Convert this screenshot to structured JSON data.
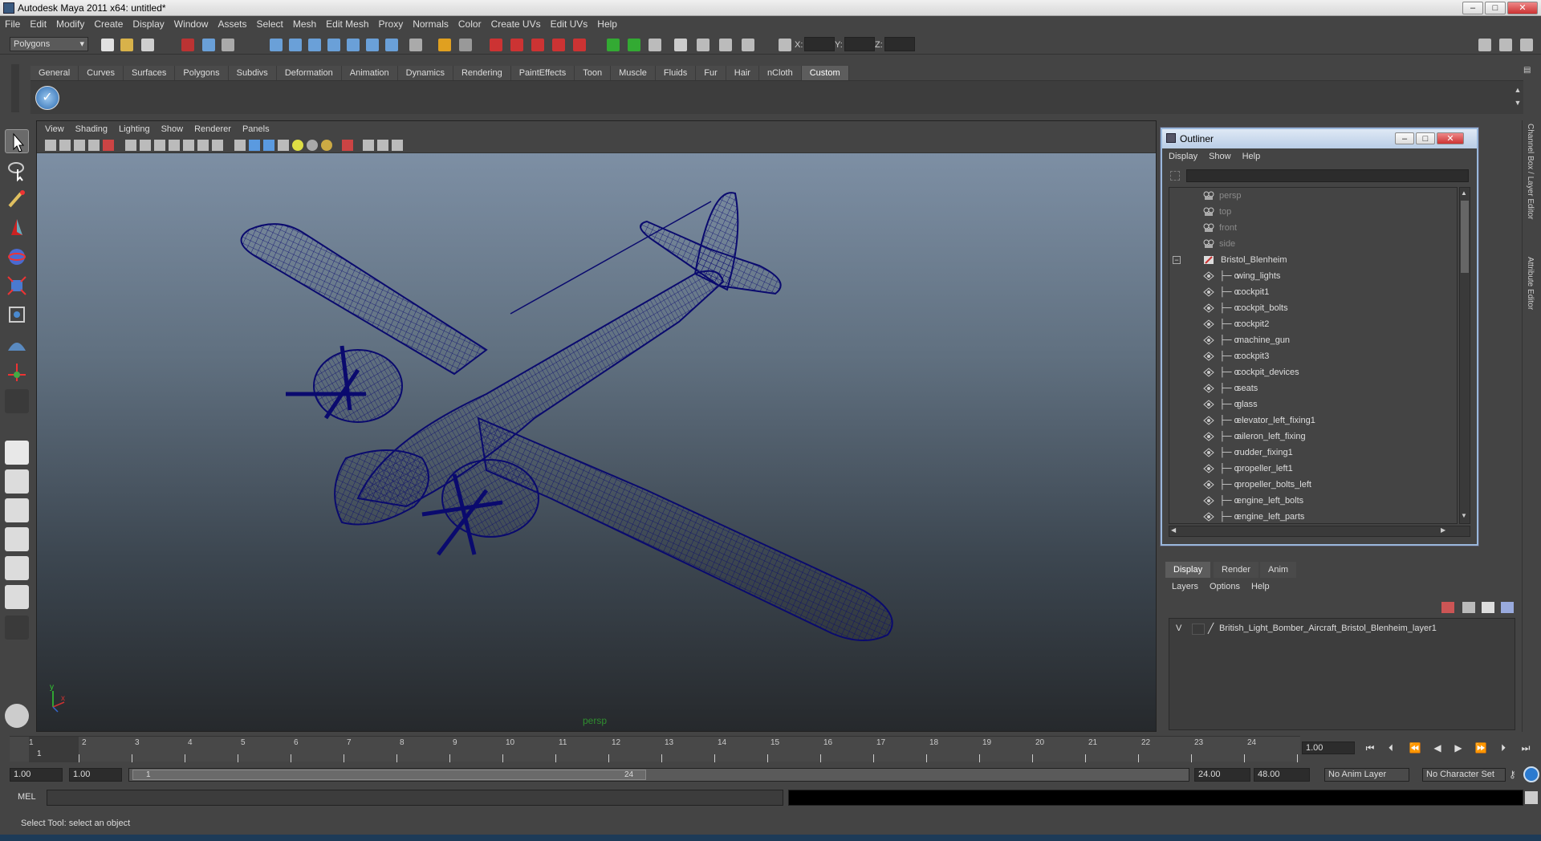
{
  "window": {
    "title": "Autodesk Maya 2011 x64: untitled*"
  },
  "menubar": {
    "items": [
      "File",
      "Edit",
      "Modify",
      "Create",
      "Display",
      "Window",
      "Assets",
      "Select",
      "Mesh",
      "Edit Mesh",
      "Proxy",
      "Normals",
      "Color",
      "Create UVs",
      "Edit UVs",
      "Help"
    ]
  },
  "statusline": {
    "mode": "Polygons",
    "coords": {
      "x_label": "X:",
      "y_label": "Y:",
      "z_label": "Z:"
    }
  },
  "shelf": {
    "tabs": [
      "General",
      "Curves",
      "Surfaces",
      "Polygons",
      "Subdivs",
      "Deformation",
      "Animation",
      "Dynamics",
      "Rendering",
      "PaintEffects",
      "Toon",
      "Muscle",
      "Fluids",
      "Fur",
      "Hair",
      "nCloth",
      "Custom"
    ],
    "active_tab": "Custom"
  },
  "viewport": {
    "menu": [
      "View",
      "Shading",
      "Lighting",
      "Show",
      "Renderer",
      "Panels"
    ],
    "camera_label": "persp",
    "axis": {
      "y": "y",
      "x": "x"
    }
  },
  "outliner": {
    "title": "Outliner",
    "menu": [
      "Display",
      "Show",
      "Help"
    ],
    "items": [
      {
        "label": "persp",
        "kind": "camera"
      },
      {
        "label": "top",
        "kind": "camera"
      },
      {
        "label": "front",
        "kind": "camera"
      },
      {
        "label": "side",
        "kind": "camera"
      },
      {
        "label": "Bristol_Blenheim",
        "kind": "group"
      },
      {
        "label": "wing_lights",
        "kind": "mesh"
      },
      {
        "label": "cockpit1",
        "kind": "mesh"
      },
      {
        "label": "cockpit_bolts",
        "kind": "mesh"
      },
      {
        "label": "cockpit2",
        "kind": "mesh"
      },
      {
        "label": "machine_gun",
        "kind": "mesh"
      },
      {
        "label": "cockpit3",
        "kind": "mesh"
      },
      {
        "label": "cockpit_devices",
        "kind": "mesh"
      },
      {
        "label": "seats",
        "kind": "mesh"
      },
      {
        "label": "glass",
        "kind": "mesh"
      },
      {
        "label": "elevator_left_fixing1",
        "kind": "mesh"
      },
      {
        "label": "aileron_left_fixing",
        "kind": "mesh"
      },
      {
        "label": "rudder_fixing1",
        "kind": "mesh"
      },
      {
        "label": "propeller_left1",
        "kind": "mesh"
      },
      {
        "label": "propeller_bolts_left",
        "kind": "mesh"
      },
      {
        "label": "engine_left_bolts",
        "kind": "mesh"
      },
      {
        "label": "engine_left_parts",
        "kind": "mesh"
      }
    ]
  },
  "layer_editor": {
    "tabs": [
      "Display",
      "Render",
      "Anim"
    ],
    "active_tab": "Display",
    "menu": [
      "Layers",
      "Options",
      "Help"
    ],
    "layers": [
      {
        "visible": "V",
        "name": "British_Light_Bomber_Aircraft_Bristol_Blenheim_layer1"
      }
    ]
  },
  "right_strip": {
    "tabs": [
      "Channel Box / Layer Editor",
      "Attribute Editor"
    ]
  },
  "timeline": {
    "ticks": [
      "1",
      "2",
      "3",
      "4",
      "5",
      "6",
      "7",
      "8",
      "9",
      "10",
      "11",
      "12",
      "13",
      "14",
      "15",
      "16",
      "17",
      "18",
      "19",
      "20",
      "21",
      "22",
      "23",
      "24"
    ],
    "current_frame_marker": "1",
    "current_time": "1.00"
  },
  "range": {
    "start_time": "1.00",
    "playback_start": "1.00",
    "range_start_label": "1",
    "range_end_label": "24",
    "playback_end": "24.00",
    "end_time": "48.00",
    "anim_layer": "No Anim Layer",
    "character_set": "No Character Set"
  },
  "cmdline": {
    "label": "MEL"
  },
  "helpline": {
    "text": "Select Tool: select an object"
  },
  "colors": {
    "wireframe": "#0a0a6e",
    "viewport_top": "#7d8fa4",
    "viewport_bottom": "#26292c",
    "ui_bg": "#444444"
  }
}
